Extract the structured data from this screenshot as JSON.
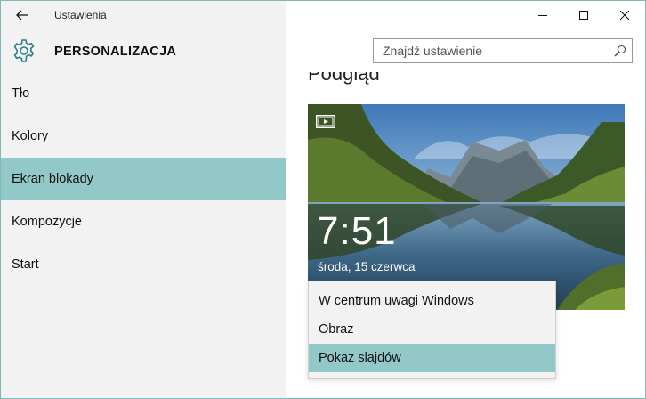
{
  "window": {
    "title": "Ustawienia",
    "controls": [
      "minimize",
      "maximize",
      "close"
    ]
  },
  "header": {
    "section_title": "PERSONALIZACJA",
    "search_placeholder": "Znajdź ustawienie"
  },
  "sidebar": {
    "items": [
      {
        "label": "Tło",
        "active": false
      },
      {
        "label": "Kolory",
        "active": false
      },
      {
        "label": "Ekran blokady",
        "active": true
      },
      {
        "label": "Kompozycje",
        "active": false
      },
      {
        "label": "Start",
        "active": false
      }
    ]
  },
  "main": {
    "heading": "Podgląd",
    "lock_preview": {
      "time": "7:51",
      "date": "środa, 15 czerwca"
    },
    "background_dropdown": {
      "options": [
        "W centrum uwagi Windows",
        "Obraz",
        "Pokaz slajdów"
      ],
      "selected": "Pokaz slajdów"
    }
  },
  "colors": {
    "accent": "#93c8c8",
    "sidebar_bg": "#f2f2f2",
    "window_border": "#7fb8b5"
  },
  "icons": [
    "back-arrow-icon",
    "minimize-icon",
    "maximize-icon",
    "close-icon",
    "gear-icon",
    "search-icon",
    "slideshow-icon"
  ]
}
